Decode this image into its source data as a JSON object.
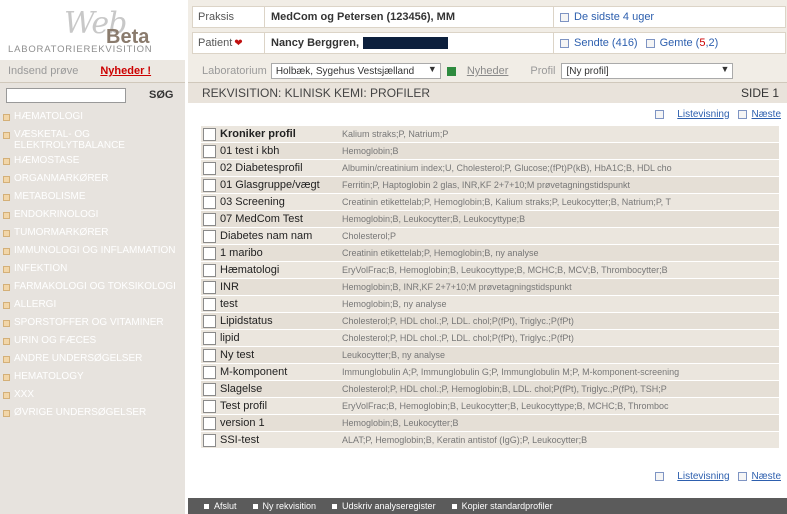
{
  "logo": {
    "text_web": "Web",
    "text_beta": "Beta",
    "subtitle": "LABORATORIEREKVISITION"
  },
  "header": {
    "praksis_label": "Praksis",
    "praksis_value": "MedCom og Petersen (123456), MM",
    "period_link": "De sidste 4 uger",
    "patient_label": "Patient",
    "patient_value": "Nancy Berggren,",
    "sent_link": "Sendte (416)",
    "saved_label": "Gemte (",
    "saved_count": "5",
    "saved_suffix": ",2)"
  },
  "sidebar": {
    "send_sample": "Indsend prøve",
    "news": "Nyheder !",
    "search_placeholder": "",
    "search_button": "SØG",
    "items": [
      "HÆMATOLOGI",
      "VÆSKETAL- OG ELEKTROLYTBALANCE",
      "HÆMOSTASE",
      "ORGANMARKØRER",
      "METABOLISME",
      "ENDOKRINOLOGI",
      "TUMORMARKØRER",
      "IMMUNOLOGI OG INFLAMMATION",
      "INFEKTION",
      "FARMAKOLOGI OG TOKSIKOLOGI",
      "ALLERGI",
      "SPORSTOFFER OG VITAMINER",
      "URIN OG FÆCES",
      "ANDRE UNDERSØGELSER",
      "HEMATOLOGY",
      "XXX",
      "ØVRIGE UNDERSØGELSER"
    ]
  },
  "labbar": {
    "lab_label": "Laboratorium",
    "lab_value": "Holbæk, Sygehus Vestsjælland",
    "news_link": "Nyheder",
    "profile_label": "Profil",
    "profile_value": "[Ny profil]"
  },
  "title": {
    "text": "REKVISITION: KLINISK KEMI: PROFILER",
    "page": "SIDE 1"
  },
  "nav": {
    "list_view": "Listevisning",
    "next": "Næste"
  },
  "profiles": [
    {
      "name": "Kroniker profil",
      "analyses": "Kalium straks;P, Natrium;P",
      "bold": true
    },
    {
      "name": "01 test i kbh",
      "analyses": "Hemoglobin;B"
    },
    {
      "name": "02 Diabetesprofil",
      "analyses": "Albumin/creatinium index;U, Cholesterol;P, Glucose;(fPt)P(kB), HbA1C;B, HDL cho"
    },
    {
      "name": "01 Glasgruppe/vægt",
      "analyses": "Ferritin;P, Haptoglobin 2 glas, INR,KF 2+7+10;M prøvetagningstidspunkt"
    },
    {
      "name": "03 Screening",
      "analyses": "Creatinin etikettelab;P, Hemoglobin;B, Kalium straks;P, Leukocytter;B, Natrium;P, T"
    },
    {
      "name": "07 MedCom Test",
      "analyses": "Hemoglobin;B, Leukocytter;B, Leukocyttype;B"
    },
    {
      "name": "Diabetes nam nam",
      "analyses": "Cholesterol;P"
    },
    {
      "name": "1 maribo",
      "analyses": "Creatinin etikettelab;P, Hemoglobin;B, ny analyse"
    },
    {
      "name": "Hæmatologi",
      "analyses": "EryVolFrac;B, Hemoglobin;B, Leukocyttype;B, MCHC;B, MCV;B, Thrombocytter;B"
    },
    {
      "name": "INR",
      "analyses": "Hemoglobin;B, INR,KF 2+7+10;M prøvetagningstidspunkt"
    },
    {
      "name": "test",
      "analyses": "Hemoglobin;B, ny analyse"
    },
    {
      "name": "Lipidstatus",
      "analyses": "Cholesterol;P, HDL chol.;P, LDL. chol;P(fPt), Triglyc.;P(fPt)"
    },
    {
      "name": "lipid",
      "analyses": "Cholesterol;P, HDL chol.;P, LDL. chol;P(fPt), Triglyc.;P(fPt)"
    },
    {
      "name": "Ny test",
      "analyses": "Leukocytter;B, ny analyse"
    },
    {
      "name": "M-komponent",
      "analyses": "Immunglobulin A;P, Immunglobulin G;P, Immunglobulin M;P, M-komponent-screening"
    },
    {
      "name": "Slagelse",
      "analyses": "Cholesterol;P, HDL chol.;P, Hemoglobin;B, LDL. chol;P(fPt), Triglyc.;P(fPt), TSH;P"
    },
    {
      "name": "Test profil",
      "analyses": "EryVolFrac;B, Hemoglobin;B, Leukocytter;B, Leukocyttype;B, MCHC;B, Thromboc"
    },
    {
      "name": "version 1",
      "analyses": "Hemoglobin;B, Leukocytter;B"
    },
    {
      "name": "SSI-test",
      "analyses": "ALAT;P, Hemoglobin;B, Keratin antistof (IgG);P, Leukocytter;B"
    }
  ],
  "footer": {
    "quit": "Afslut",
    "new_req": "Ny rekvisition",
    "print_reg": "Udskriv analyseregister",
    "copy_std": "Kopier standardprofiler"
  }
}
